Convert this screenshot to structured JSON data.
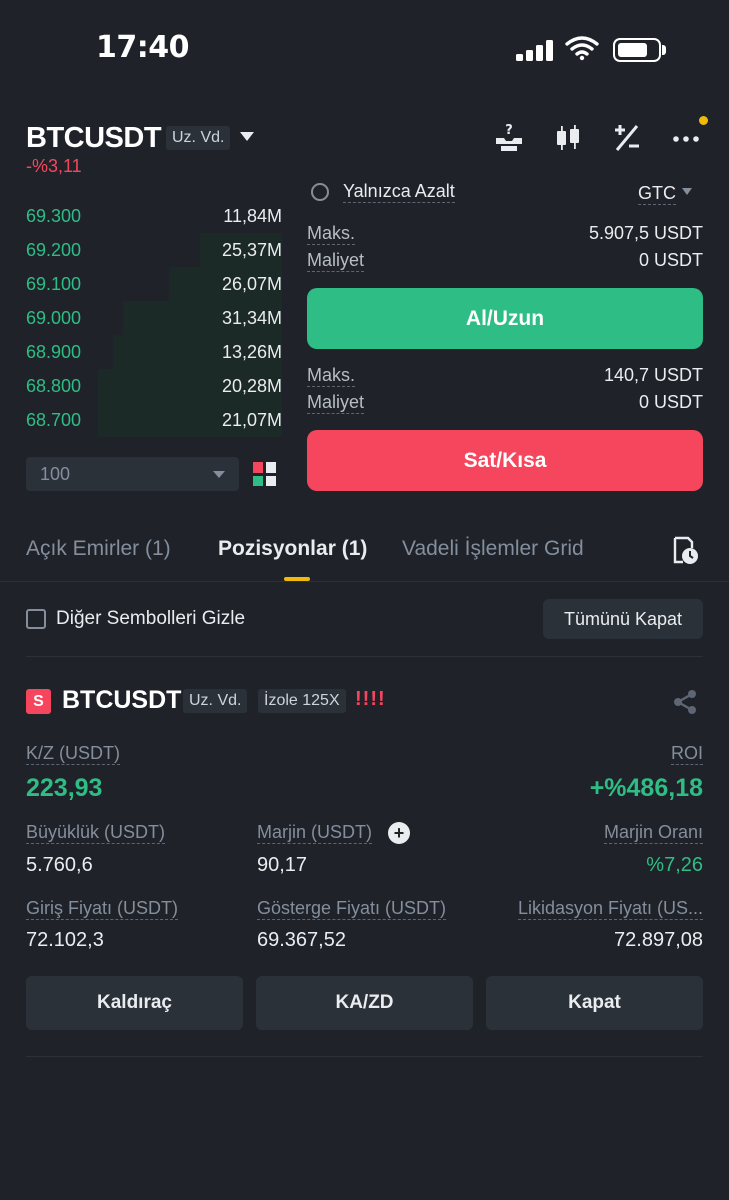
{
  "status_bar": {
    "time": "17:40"
  },
  "header": {
    "symbol": "BTCUSDT",
    "contract_tag": "Uz. Vd.",
    "change": "-%3,11",
    "icons": [
      "question-tray-icon",
      "candlestick-icon",
      "percent-icon",
      "more-icon"
    ]
  },
  "order_book": {
    "rows": [
      {
        "price": "69.300",
        "qty": "11,84M",
        "depth": 0.0
      },
      {
        "price": "69.200",
        "qty": "25,37M",
        "depth": 0.32
      },
      {
        "price": "69.100",
        "qty": "26,07M",
        "depth": 0.44
      },
      {
        "price": "69.000",
        "qty": "31,34M",
        "depth": 0.62
      },
      {
        "price": "68.900",
        "qty": "13,26M",
        "depth": 0.66
      },
      {
        "price": "68.800",
        "qty": "20,28M",
        "depth": 0.72
      },
      {
        "price": "68.700",
        "qty": "21,07M",
        "depth": 0.72
      }
    ],
    "depth_select": "100"
  },
  "order_form": {
    "reduce_only": "Yalnızca Azalt",
    "time_in_force": "GTC",
    "buy": {
      "max_label": "Maks.",
      "max_value": "5.907,5 USDT",
      "cost_label": "Maliyet",
      "cost_value": "0 USDT",
      "button": "Al/Uzun"
    },
    "sell": {
      "max_label": "Maks.",
      "max_value": "140,7 USDT",
      "cost_label": "Maliyet",
      "cost_value": "0 USDT",
      "button": "Sat/Kısa"
    }
  },
  "tabs": [
    "Açık Emirler (1)",
    "Pozisyonlar (1)",
    "Vadeli İşlemler Grid"
  ],
  "positions": {
    "hide_other": "Diğer Sembolleri Gizle",
    "close_all": "Tümünü Kapat",
    "card": {
      "side": "S",
      "symbol": "BTCUSDT",
      "contract_tag": "Uz. Vd.",
      "margin_tag": "İzole 125X",
      "risk": "!!!!",
      "pnl_label": "K/Z (USDT)",
      "pnl_value": "223,93",
      "roi_label": "ROI",
      "roi_value": "+%486,18",
      "size_label": "Büyüklük (USDT)",
      "size_value": "5.760,6",
      "margin_label": "Marjin (USDT)",
      "margin_value": "90,17",
      "margin_ratio_label": "Marjin Oranı",
      "margin_ratio_value": "%7,26",
      "entry_label": "Giriş Fiyatı (USDT)",
      "entry_value": "72.102,3",
      "mark_label": "Gösterge Fiyatı (USDT)",
      "mark_value": "69.367,52",
      "liq_label": "Likidasyon Fiyatı (US...",
      "liq_value": "72.897,08",
      "buttons": [
        "Kaldıraç",
        "KA/ZD",
        "Kapat"
      ]
    }
  },
  "colors": {
    "bg": "#1f2329",
    "green": "#2ebd85",
    "red": "#f6465d",
    "accent": "#f0b90b"
  }
}
